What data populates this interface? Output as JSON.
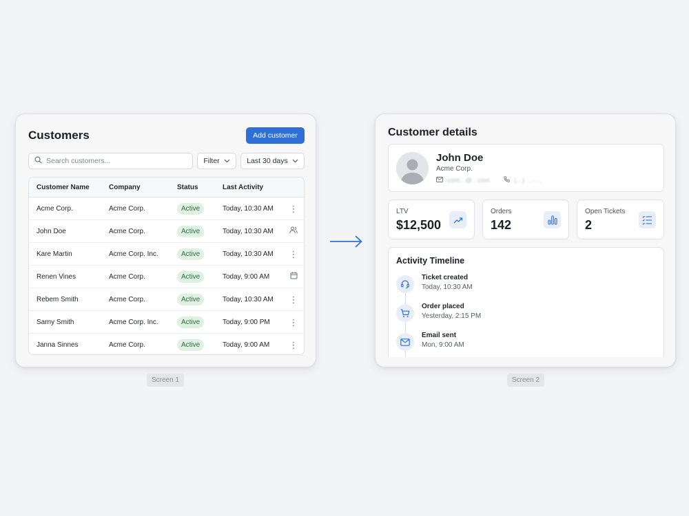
{
  "screen1": {
    "title": "Customers",
    "add_button": "Add customer",
    "search_placeholder": "Search customers...",
    "filter_label": "Filter",
    "range_label": "Last 30 days",
    "columns": [
      "Customer Name",
      "Company",
      "Status",
      "Last Activity"
    ],
    "rows": [
      {
        "name": "Acme Corp.",
        "company": "Acme Corp.",
        "status": "Active",
        "activity": "Today, 10:30 AM",
        "action_icon": "more-vertical-icon"
      },
      {
        "name": "John Doe",
        "company": "Acme Corp.",
        "status": "Active",
        "activity": "Today, 10:30 AM",
        "action_icon": "users-icon"
      },
      {
        "name": "Kare Martin",
        "company": "Acme Corp. Inc.",
        "status": "Active",
        "activity": "Today, 10:30 AM",
        "action_icon": "more-vertical-icon"
      },
      {
        "name": "Renen Vines",
        "company": "Acme Corp.",
        "status": "Active",
        "activity": "Today, 9:00 AM",
        "action_icon": "calendar-icon"
      },
      {
        "name": "Rebem Smith",
        "company": "Acme Corp.",
        "status": "Active",
        "activity": "Today, 10:30 AM",
        "action_icon": "more-vertical-icon"
      },
      {
        "name": "Sarny Smith",
        "company": "Acme Corp. Inc.",
        "status": "Active",
        "activity": "Today, 9:00 PM",
        "action_icon": "more-vertical-icon"
      },
      {
        "name": "Janna Sinnes",
        "company": "Acme Corp.",
        "status": "Active",
        "activity": "Today, 9:00 AM",
        "action_icon": "more-vertical-icon"
      }
    ],
    "caption": "Screen 1"
  },
  "screen2": {
    "title": "Customer details",
    "profile": {
      "name": "John Doe",
      "company": "Acme Corp.",
      "email": "cont...@...com",
      "phone": "(...) ...-...."
    },
    "stats": [
      {
        "label": "LTV",
        "value": "$12,500",
        "icon": "trending-up-icon"
      },
      {
        "label": "Orders",
        "value": "142",
        "icon": "bar-chart-icon"
      },
      {
        "label": "Open Tickets",
        "value": "2",
        "icon": "checklist-icon"
      }
    ],
    "timeline": {
      "title": "Activity Timeline",
      "items": [
        {
          "event": "Ticket created",
          "time": "Today, 10:30 AM",
          "icon": "headset-icon"
        },
        {
          "event": "Order placed",
          "time": "Yesterday, 2:15 PM",
          "icon": "cart-icon"
        },
        {
          "event": "Email sent",
          "time": "Mon, 9:00 AM",
          "icon": "mail-icon"
        }
      ]
    },
    "caption": "Screen 2"
  },
  "colors": {
    "accent": "#2f6fd6",
    "badge_bg": "#dff1e3",
    "badge_text": "#2f6a3d",
    "icon_bg": "#e8eef8"
  }
}
